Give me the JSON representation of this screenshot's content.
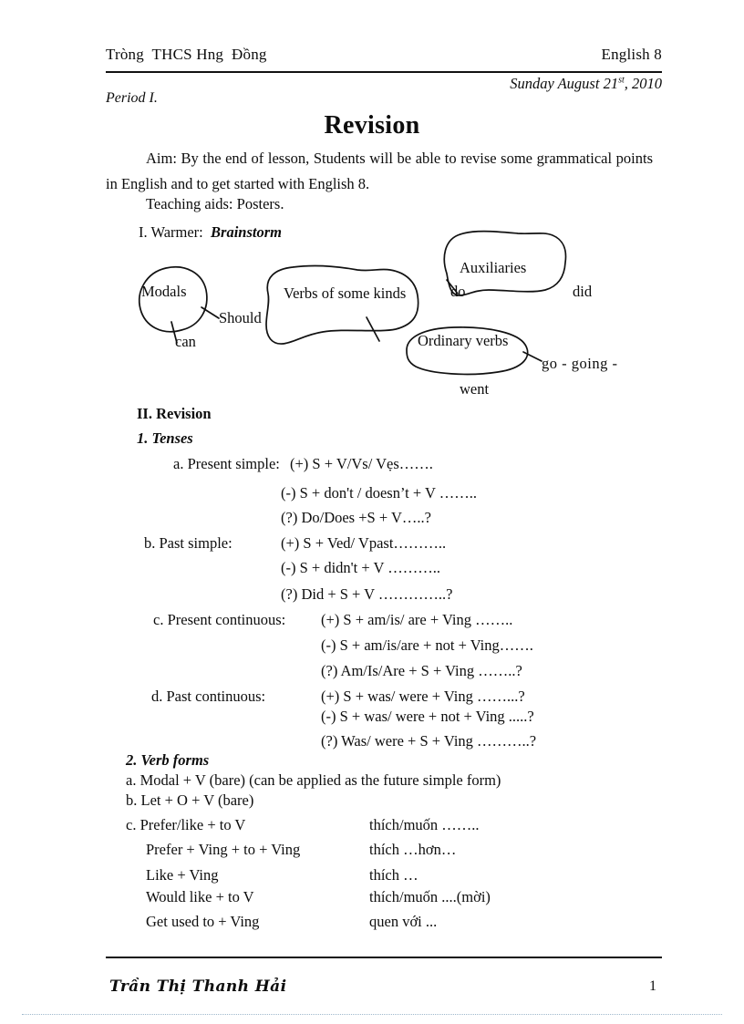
{
  "header": {
    "school": "Tròng  THCS Hng  Đồng",
    "class": "English 8",
    "date": "Sunday August 21",
    "date_sup": "st",
    "date_year": ", 2010",
    "period": "Period I."
  },
  "title": "Revision",
  "intro": {
    "aim": "Aim: By the end of lesson, Students will be able to revise some grammatical points in English and to get started with English 8.",
    "teaching_aids": "Teaching aids: Posters.",
    "warmer_label": "I. Warmer:",
    "warmer_value": "Brainstorm"
  },
  "diagram": {
    "modals": "Modals",
    "should": "Should",
    "can": "can",
    "verbs_of_some_kinds": "Verbs of some kinds",
    "auxiliaries": "Auxiliaries",
    "do": "do",
    "did": "did",
    "ordinary_verbs": "Ordinary verbs",
    "go_going": "go  -  going  -",
    "went": "went"
  },
  "revision": {
    "heading": "II. Revision",
    "tenses_heading": "1. Tenses",
    "tenses": [
      {
        "name": "a. Present simple:",
        "forms": [
          "(+) S + V/Vs/ Vẹs…….",
          "(-) S + don't / doesn’t + V ……..",
          "(?) Do/Does +S + V…..?"
        ]
      },
      {
        "name": "b. Past simple:",
        "forms": [
          "(+) S + Ved/ Vpast………..",
          "(-) S + didn't + V ………..",
          "(?) Did + S + V …………..?"
        ]
      },
      {
        "name": "c. Present continuous:",
        "forms": [
          "(+) S + am/is/ are + Ving ……..",
          "(-) S + am/is/are + not + Ving…….",
          "(?) Am/Is/Are + S + Ving ……..?"
        ]
      },
      {
        "name": "d. Past continuous:",
        "forms": [
          "(+) S + was/ were + Ving ……...?",
          "(-) S + was/ were + not  + Ving .....?",
          "(?) Was/ were + S + Ving ………..?"
        ]
      }
    ],
    "verb_forms_heading": "2. Verb forms",
    "verb_forms": [
      "a. Modal + V (bare) (can be applied as the future simple form)",
      "b. Let + O + V (bare)"
    ],
    "prefer_rows": [
      {
        "en": "c. Prefer/like + to V",
        "vi": "thích/muốn …….."
      },
      {
        "en": "Prefer + Ving + to + Ving",
        "vi": "thích …hơn…"
      },
      {
        "en": "Like  + Ving",
        "vi": "thích …"
      },
      {
        "en": "Would like + to V",
        "vi": "thích/muốn ....(mời)"
      },
      {
        "en": "Get used to + Ving",
        "vi": "quen với ..."
      }
    ]
  },
  "footer": {
    "author": "Trần Thị Thanh Hải",
    "page": "1"
  }
}
